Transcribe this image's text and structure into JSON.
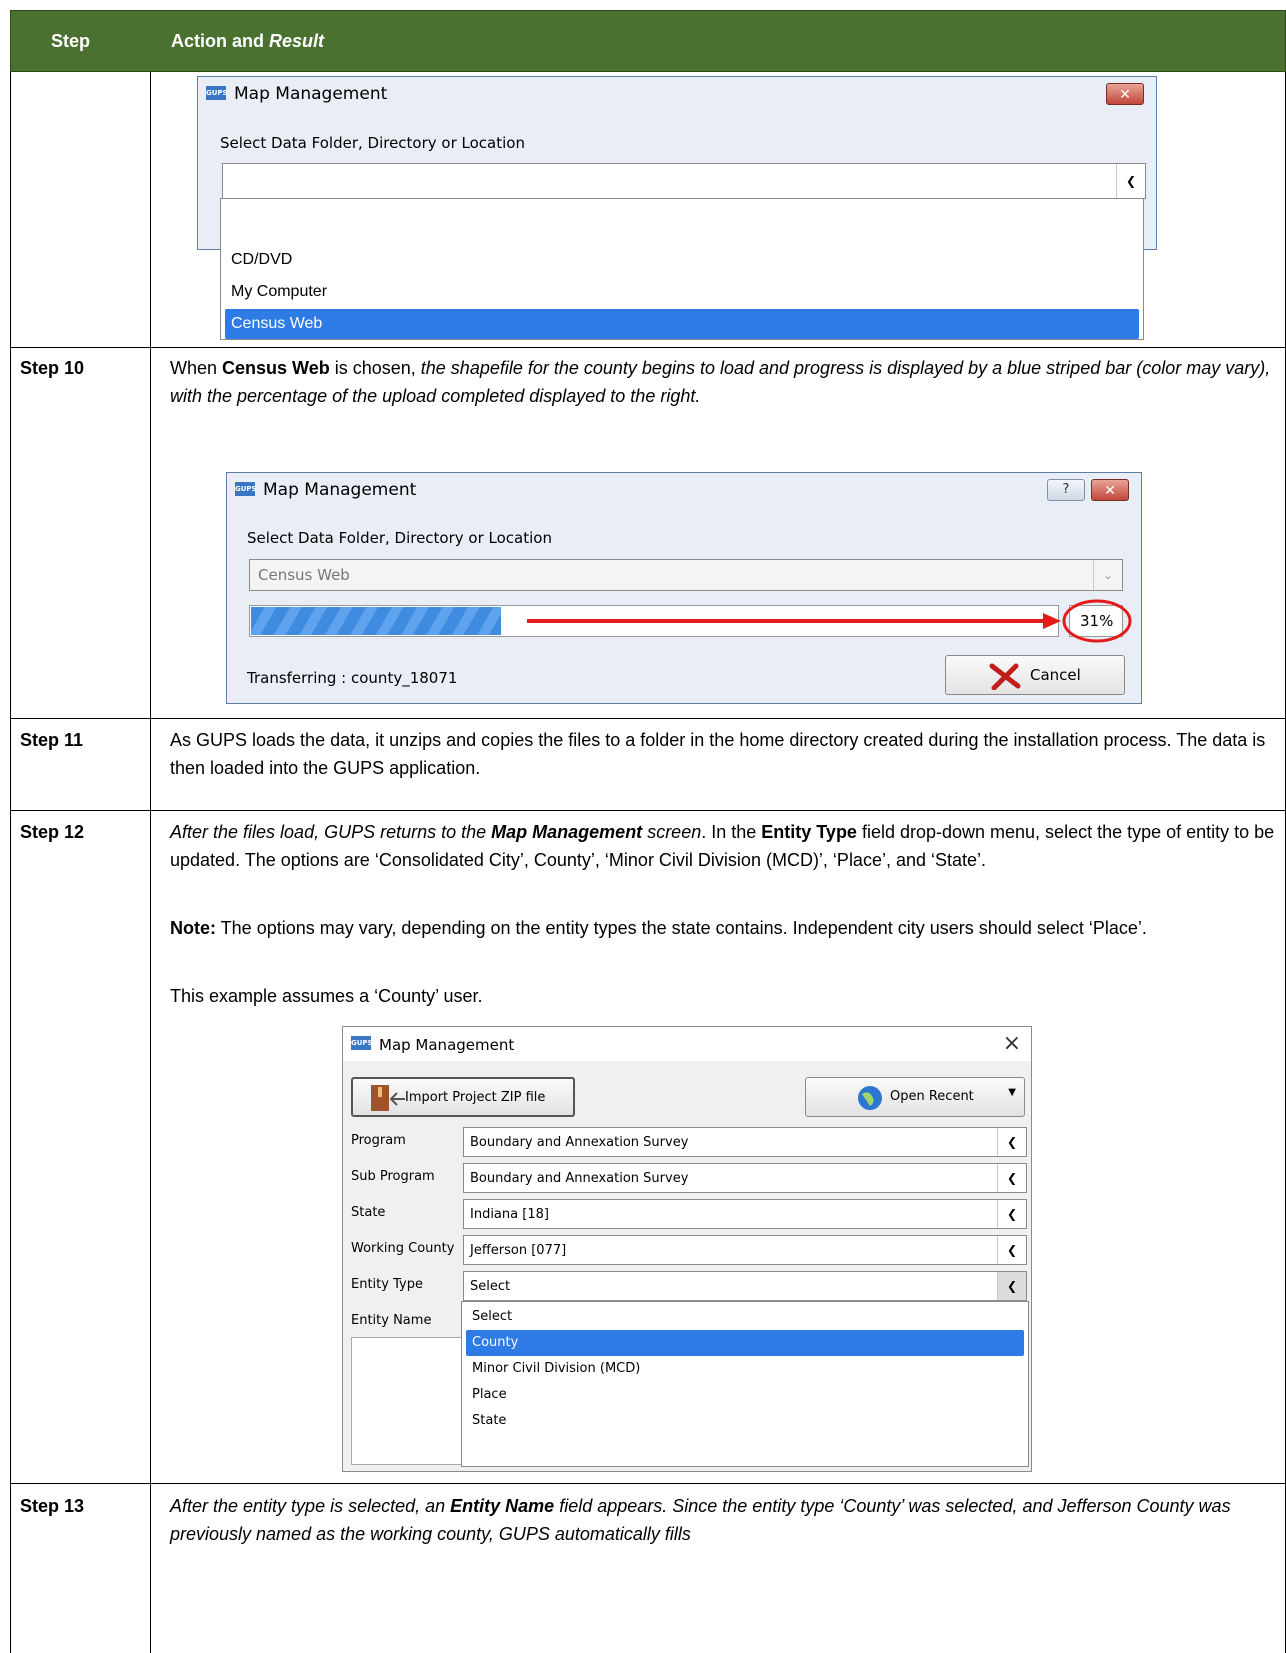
{
  "header": {
    "col_step": "Step",
    "col_action": "Action and ",
    "col_action_italic": "Result"
  },
  "dialog1": {
    "title": "Map Management",
    "select_label": "Select Data Folder, Directory or Location",
    "combo_value": "",
    "options": [
      "CD/DVD",
      "My Computer",
      "Census Web"
    ],
    "selected_index": 2,
    "close_glyph": "✕"
  },
  "step10": {
    "label": "Step 10",
    "t1": "When ",
    "t2": "Census Web",
    "t3": " is chosen, ",
    "t4": "the shapefile for the county begins to load and progress is displayed by a blue striped bar (color may vary), with the percentage of the upload completed displayed to the right."
  },
  "dialog2": {
    "title": "Map Management",
    "select_label": "Select Data Folder, Directory or Location",
    "combo_value": "Census Web",
    "progress_fraction": 0.31,
    "percent_text": "31%",
    "status": "Transferring : county_18071",
    "cancel": "Cancel",
    "help_glyph": "?",
    "close_glyph": "✕"
  },
  "step11": {
    "label": "Step 11",
    "text": "As GUPS loads the data, it unzips and copies the files to a folder in the home directory created during the installation process. The data is then loaded into the GUPS application."
  },
  "step12": {
    "label": "Step 12",
    "p1a": "After the files load, GUPS returns to the ",
    "p1b": "Map Management",
    "p1c": " screen",
    "p1d": ". In the ",
    "p1e": "Entity Type",
    "p1f": " field drop-down menu, select the type of entity to be updated. The options are ‘Consolidated City’, County’, ‘Minor Civil Division (MCD)’, ‘Place’, and ‘State’.",
    "note_label": "Note:",
    "note_text": "  The options may vary, depending on the entity types the state contains. Independent city users should select ‘Place’.",
    "example": "This example assumes a ‘County’ user."
  },
  "dialog3": {
    "title": "Map Management",
    "import_btn": "Import Project ZIP file",
    "open_recent": "Open Recent",
    "fields": [
      {
        "label": "Program",
        "value": "Boundary and Annexation Survey"
      },
      {
        "label": "Sub Program",
        "value": "Boundary and Annexation Survey"
      },
      {
        "label": "State",
        "value": "Indiana [18]"
      },
      {
        "label": "Working County",
        "value": "Jefferson [077]"
      },
      {
        "label": "Entity Type",
        "value": "Select"
      }
    ],
    "entity_name_label": "Entity Name",
    "options": [
      "Select",
      "County",
      "Minor Civil Division (MCD)",
      "Place",
      "State"
    ],
    "selected_index": 1,
    "close_glyph": "×"
  },
  "step13": {
    "label": "Step 13",
    "t1": "After the entity type is selected, an ",
    "t2": "Entity Name",
    "t3": " field appears. Since the entity type ‘County’ was selected, and Jefferson County was previously named as the working county, GUPS automatically fills"
  }
}
